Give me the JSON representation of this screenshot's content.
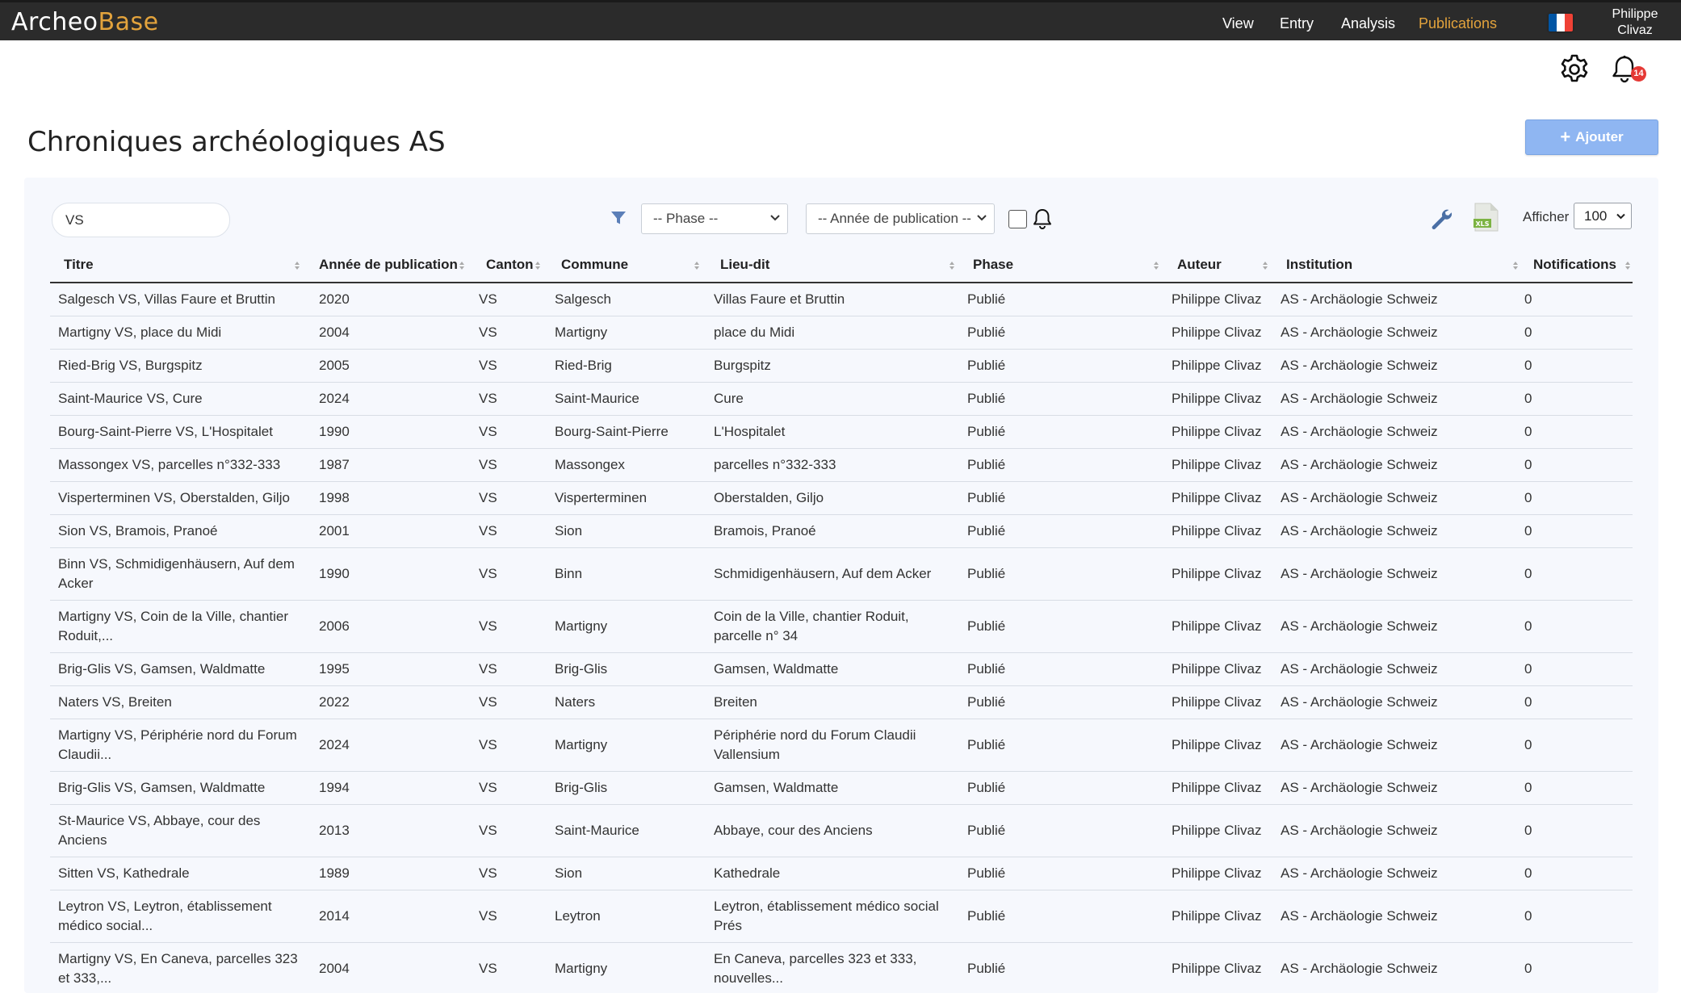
{
  "app": {
    "logo_part1": "Archeo",
    "logo_part2": "Base",
    "nav": [
      "View",
      "Entry",
      "Analysis",
      "Publications"
    ],
    "active_nav": "Publications",
    "user_line1": "Philippe",
    "user_line2": "Clivaz",
    "notification_count": "14",
    "colors": {
      "navbar": "#2b2b2b",
      "accent": "#e3a33c",
      "button": "#8fb6f2",
      "badge": "#e53935"
    }
  },
  "page": {
    "title": "Chroniques archéologiques AS",
    "add_label": "Ajouter"
  },
  "filters": {
    "search_value": "VS",
    "phase_placeholder": "-- Phase --",
    "year_placeholder": "-- Année de publication --",
    "show_label": "Afficher",
    "show_value": "100"
  },
  "table": {
    "columns": [
      "Titre",
      "Année de publication",
      "Canton",
      "Commune",
      "Lieu-dit",
      "Phase",
      "Auteur",
      "Institution",
      "Notifications"
    ],
    "rows": [
      {
        "titre": [
          "Salgesch VS, Villas Faure et Bruttin"
        ],
        "annee": "2020",
        "canton": "VS",
        "commune": "Salgesch",
        "lieu": [
          "Villas Faure et Bruttin"
        ],
        "phase": "Publié",
        "auteur": "Philippe Clivaz",
        "institution": "AS - Archäologie Schweiz",
        "notif": "0"
      },
      {
        "titre": [
          "Martigny VS, place du Midi"
        ],
        "annee": "2004",
        "canton": "VS",
        "commune": "Martigny",
        "lieu": [
          "place du Midi"
        ],
        "phase": "Publié",
        "auteur": "Philippe Clivaz",
        "institution": "AS - Archäologie Schweiz",
        "notif": "0"
      },
      {
        "titre": [
          "Ried-Brig VS, Burgspitz"
        ],
        "annee": "2005",
        "canton": "VS",
        "commune": "Ried-Brig",
        "lieu": [
          "Burgspitz"
        ],
        "phase": "Publié",
        "auteur": "Philippe Clivaz",
        "institution": "AS - Archäologie Schweiz",
        "notif": "0"
      },
      {
        "titre": [
          "Saint-Maurice VS, Cure"
        ],
        "annee": "2024",
        "canton": "VS",
        "commune": "Saint-Maurice",
        "lieu": [
          "Cure"
        ],
        "phase": "Publié",
        "auteur": "Philippe Clivaz",
        "institution": "AS - Archäologie Schweiz",
        "notif": "0"
      },
      {
        "titre": [
          "Bourg-Saint-Pierre VS, L'Hospitalet"
        ],
        "annee": "1990",
        "canton": "VS",
        "commune": "Bourg-Saint-Pierre",
        "lieu": [
          "L'Hospitalet"
        ],
        "phase": "Publié",
        "auteur": "Philippe Clivaz",
        "institution": "AS - Archäologie Schweiz",
        "notif": "0"
      },
      {
        "titre": [
          "Massongex VS, parcelles n°332-333"
        ],
        "annee": "1987",
        "canton": "VS",
        "commune": "Massongex",
        "lieu": [
          "parcelles n°332-333"
        ],
        "phase": "Publié",
        "auteur": "Philippe Clivaz",
        "institution": "AS - Archäologie Schweiz",
        "notif": "0"
      },
      {
        "titre": [
          "Visperterminen VS, Oberstalden, Giljo"
        ],
        "annee": "1998",
        "canton": "VS",
        "commune": "Visperterminen",
        "lieu": [
          "Oberstalden, Giljo"
        ],
        "phase": "Publié",
        "auteur": "Philippe Clivaz",
        "institution": "AS - Archäologie Schweiz",
        "notif": "0"
      },
      {
        "titre": [
          "Sion VS, Bramois, Pranoé"
        ],
        "annee": "2001",
        "canton": "VS",
        "commune": "Sion",
        "lieu": [
          "Bramois, Pranoé"
        ],
        "phase": "Publié",
        "auteur": "Philippe Clivaz",
        "institution": "AS - Archäologie Schweiz",
        "notif": "0"
      },
      {
        "titre": [
          "Binn VS, Schmidigenhäusern, Auf dem",
          "Acker"
        ],
        "annee": "1990",
        "canton": "VS",
        "commune": "Binn",
        "lieu": [
          "Schmidigenhäusern, Auf dem Acker"
        ],
        "phase": "Publié",
        "auteur": "Philippe Clivaz",
        "institution": "AS - Archäologie Schweiz",
        "notif": "0"
      },
      {
        "titre": [
          "Martigny VS, Coin de la Ville, chantier",
          "Roduit,..."
        ],
        "annee": "2006",
        "canton": "VS",
        "commune": "Martigny",
        "lieu": [
          "Coin de la Ville, chantier Roduit,",
          "parcelle n° 34"
        ],
        "phase": "Publié",
        "auteur": "Philippe Clivaz",
        "institution": "AS - Archäologie Schweiz",
        "notif": "0"
      },
      {
        "titre": [
          "Brig-Glis VS, Gamsen, Waldmatte"
        ],
        "annee": "1995",
        "canton": "VS",
        "commune": "Brig-Glis",
        "lieu": [
          "Gamsen, Waldmatte"
        ],
        "phase": "Publié",
        "auteur": "Philippe Clivaz",
        "institution": "AS - Archäologie Schweiz",
        "notif": "0"
      },
      {
        "titre": [
          "Naters VS, Breiten"
        ],
        "annee": "2022",
        "canton": "VS",
        "commune": "Naters",
        "lieu": [
          "Breiten"
        ],
        "phase": "Publié",
        "auteur": "Philippe Clivaz",
        "institution": "AS - Archäologie Schweiz",
        "notif": "0"
      },
      {
        "titre": [
          "Martigny VS, Périphérie nord du Forum",
          "Claudii..."
        ],
        "annee": "2024",
        "canton": "VS",
        "commune": "Martigny",
        "lieu": [
          "Périphérie nord du Forum Claudii",
          "Vallensium"
        ],
        "phase": "Publié",
        "auteur": "Philippe Clivaz",
        "institution": "AS - Archäologie Schweiz",
        "notif": "0"
      },
      {
        "titre": [
          "Brig-Glis VS, Gamsen, Waldmatte"
        ],
        "annee": "1994",
        "canton": "VS",
        "commune": "Brig-Glis",
        "lieu": [
          "Gamsen, Waldmatte"
        ],
        "phase": "Publié",
        "auteur": "Philippe Clivaz",
        "institution": "AS - Archäologie Schweiz",
        "notif": "0"
      },
      {
        "titre": [
          "St-Maurice VS, Abbaye, cour des",
          "Anciens"
        ],
        "annee": "2013",
        "canton": "VS",
        "commune": "Saint-Maurice",
        "lieu": [
          "Abbaye, cour des Anciens"
        ],
        "phase": "Publié",
        "auteur": "Philippe Clivaz",
        "institution": "AS - Archäologie Schweiz",
        "notif": "0"
      },
      {
        "titre": [
          "Sitten VS, Kathedrale"
        ],
        "annee": "1989",
        "canton": "VS",
        "commune": "Sion",
        "lieu": [
          "Kathedrale"
        ],
        "phase": "Publié",
        "auteur": "Philippe Clivaz",
        "institution": "AS - Archäologie Schweiz",
        "notif": "0"
      },
      {
        "titre": [
          "Leytron VS, Leytron, établissement",
          "médico social..."
        ],
        "annee": "2014",
        "canton": "VS",
        "commune": "Leytron",
        "lieu": [
          "Leytron, établissement médico social",
          "Prés"
        ],
        "phase": "Publié",
        "auteur": "Philippe Clivaz",
        "institution": "AS - Archäologie Schweiz",
        "notif": "0"
      },
      {
        "titre": [
          "Martigny VS, En Caneva, parcelles 323",
          "et 333,..."
        ],
        "annee": "2004",
        "canton": "VS",
        "commune": "Martigny",
        "lieu": [
          "En Caneva, parcelles 323 et 333,",
          "nouvelles..."
        ],
        "phase": "Publié",
        "auteur": "Philippe Clivaz",
        "institution": "AS - Archäologie Schweiz",
        "notif": "0"
      }
    ]
  }
}
